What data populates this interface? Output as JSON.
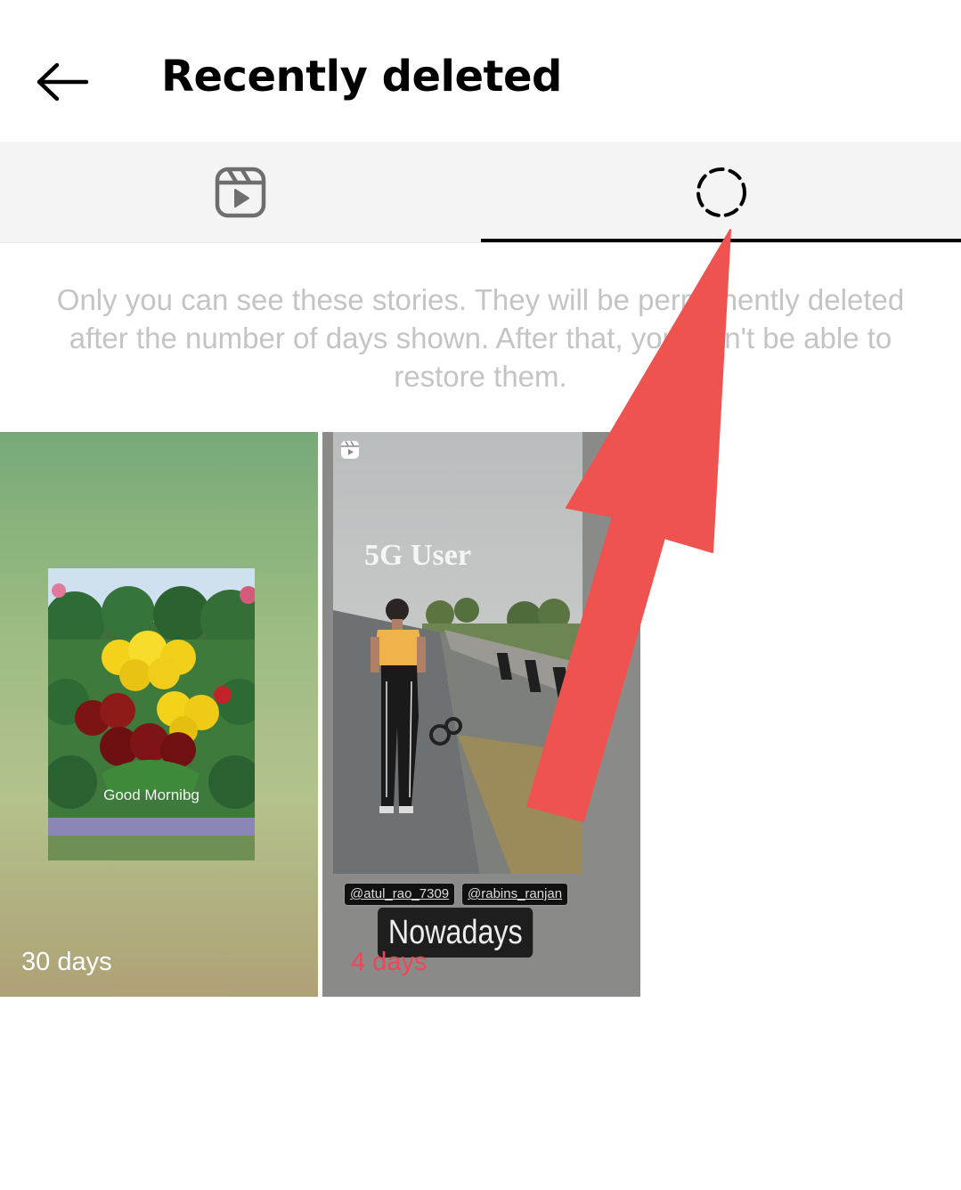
{
  "header": {
    "title": "Recently deleted",
    "back_icon": "arrow-left-icon"
  },
  "tabs": [
    {
      "icon": "reels-icon",
      "selected": false
    },
    {
      "icon": "stories-dashed-circle-icon",
      "selected": true
    }
  ],
  "info_text": "Only you can see these stories. They will be permanently deleted after the number of days shown. After that, you won't be able to restore them.",
  "items": [
    {
      "days": "30 days",
      "days_color": "#ffffff",
      "caption": "Good Mornibg"
    },
    {
      "days": "4 days",
      "days_color": "#ef4658",
      "overlay_title": "5G User",
      "mentions": [
        "@atul_rao_7309",
        "@rabins_ranjan"
      ],
      "sticker": "Nowadays",
      "badge_icon": "reels-icon"
    }
  ],
  "annotation": {
    "icon": "red-arrow-icon",
    "color": "#ef5350"
  }
}
